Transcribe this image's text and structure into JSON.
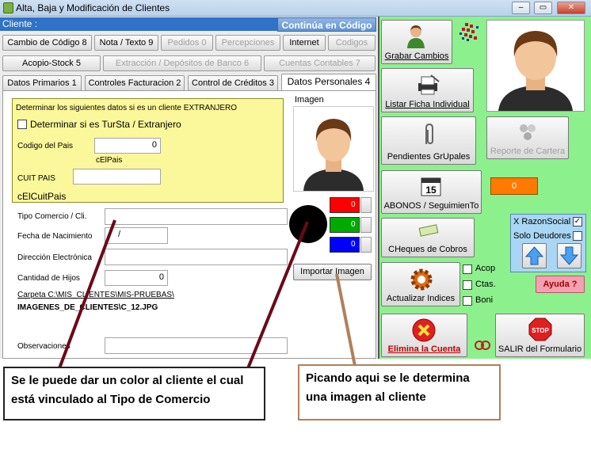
{
  "window": {
    "title": "Alta, Baja y Modificación de Clientes",
    "minimize": "–",
    "restore": "▭",
    "close": "✕"
  },
  "header": {
    "cliente_label": "Cliente :",
    "continua_button": "Continúa en Código"
  },
  "tabs_row1": [
    "Cambio de Código 8",
    "Nota / Texto 9",
    "Pedidos 0",
    "Percepciones",
    "Internet",
    "Codigos"
  ],
  "tabs_row2": [
    "Acopio-Stock 5",
    "Extracción / Depósitos de Banco 6",
    "Cuentas Contables 7"
  ],
  "tabs_row3": [
    "Datos Primarios 1",
    "Controles Facturacion 2",
    "Control de Créditos 3",
    "Datos Personales 4"
  ],
  "extranjero": {
    "heading": "Determinar los siguientes datos si es un cliente EXTRANJERO",
    "checkbox_label": "Determinar si es TurSta / Extranjero",
    "codigo_pais_label": "Codigo del Pais",
    "codigo_pais_value": "0",
    "cel_pais": "cElPais",
    "cuit_pais_label": "CUIT PAIS",
    "cuit_pais_value": "",
    "cel_cuit_pais": "cElCuitPais"
  },
  "form": {
    "tipo_comercio_label": "Tipo Comercio / Cli.",
    "fecha_nacimiento_label": "Fecha de Nacimiento",
    "fecha_nacimiento_value": "  /",
    "direccion_label": "Dirección Electrónica",
    "hijos_label": "Cantidad de Hijos",
    "hijos_value": "0",
    "carpeta": "Carpeta C:\\MIS_CLIENTES\\MIS-PRUEBAS\\",
    "imagen_path": "IMAGENES_DE_CLIENTES\\C_12.JPG",
    "observaciones_label": "Observaciones"
  },
  "imagen": {
    "label": "Imagen",
    "importar_button": "Importar Imagen"
  },
  "colors": {
    "red": "0",
    "green": "0",
    "blue": "0",
    "red_hex": "#ff0000",
    "green_hex": "#00aa00",
    "blue_hex": "#0000ff",
    "accent_hex": "#ff7700"
  },
  "right": {
    "grabar": "Grabar Cambios",
    "listar": "Listar Ficha Individual",
    "pendientes": "Pendientes GrUpales",
    "reporte": "Reporte de Cartera",
    "abonos": "ABONOS / SeguimienTo",
    "calendar_day": "15",
    "orange_value": "0",
    "razon_social": "X RazonSocial",
    "solo_deudores": "Solo Deudores",
    "cheques": "CHeques de Cobros",
    "ayuda": "Ayuda ?",
    "actualizar": "Actualizar Indices",
    "acop": "Acop",
    "ctas": "Ctas.",
    "boni": "Boni",
    "elimina": "Elimina la Cuenta",
    "salir": "SALIR del Formulario",
    "stop_text": "STOP"
  },
  "callouts": {
    "left": "Se le puede dar un color al cliente el cual está vinculado al Tipo de Comercio",
    "right": "Picando aqui se le determina una imagen al cliente"
  }
}
